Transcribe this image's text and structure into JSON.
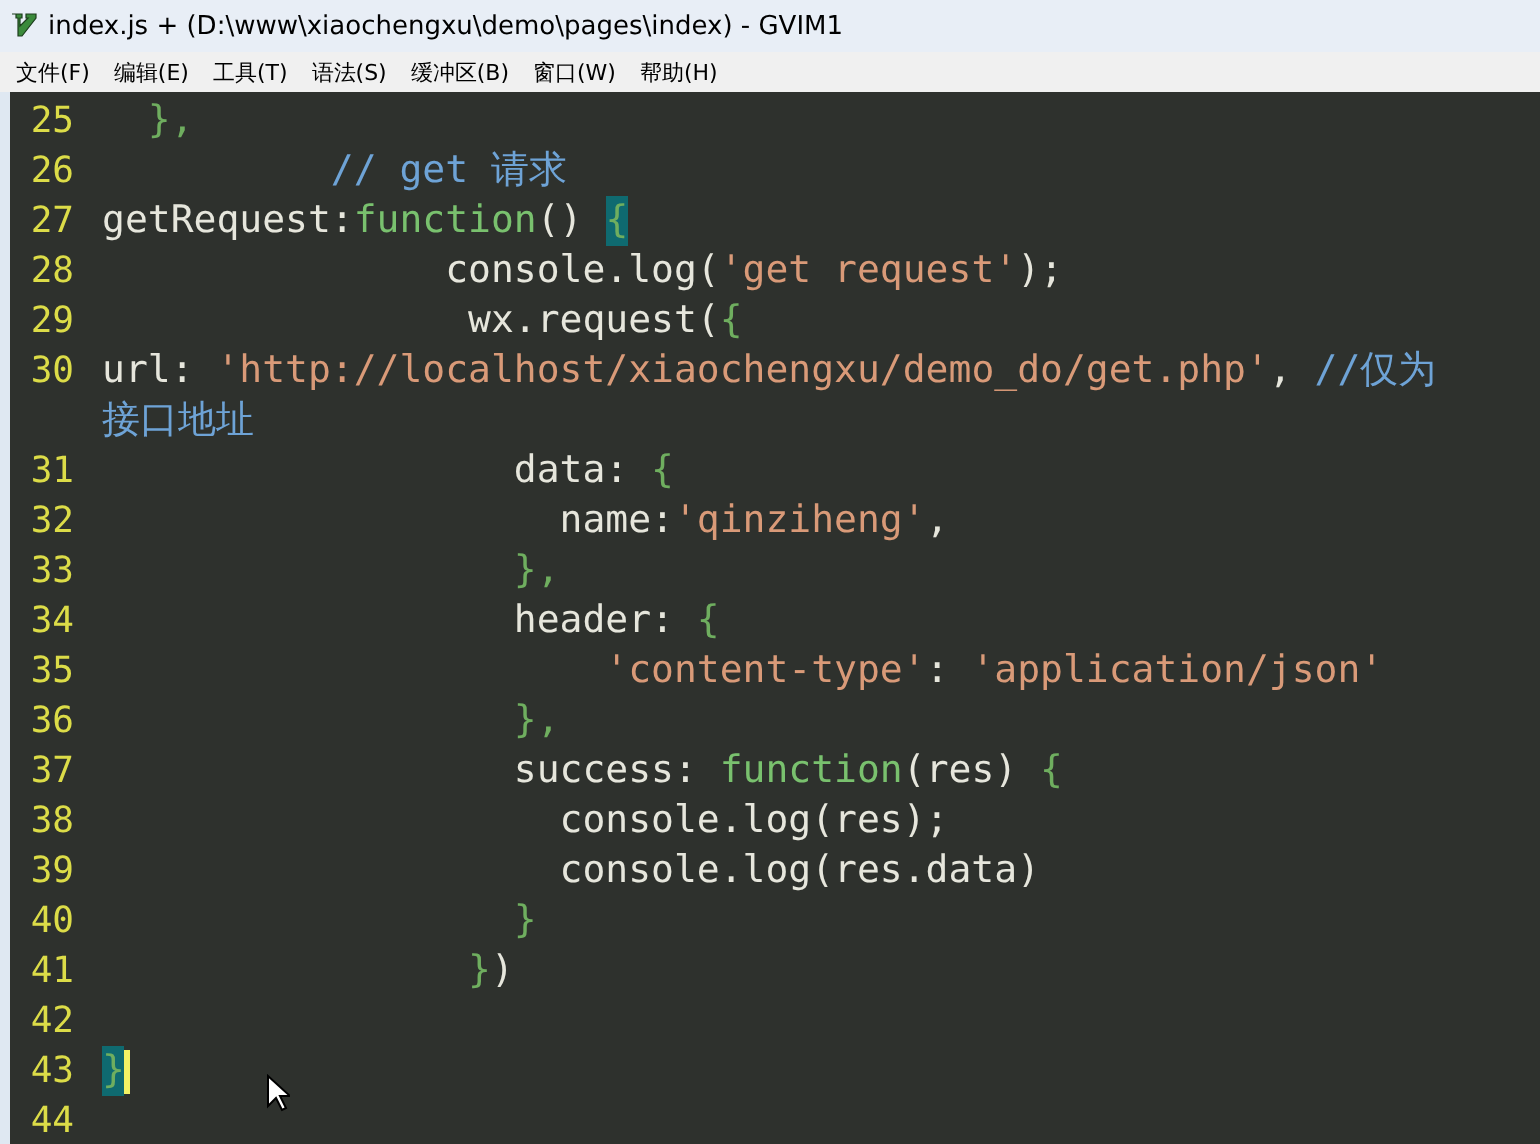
{
  "window": {
    "title": "index.js + (D:\\www\\xiaochengxu\\demo\\pages\\index) - GVIM1"
  },
  "menu": [
    "文件(F)",
    "编辑(E)",
    "工具(T)",
    "语法(S)",
    "缓冲区(B)",
    "窗口(W)",
    "帮助(H)"
  ],
  "lines": [
    {
      "number": "25",
      "cursor": false,
      "tokens": [
        {
          "kind": "punct",
          "text": "  },"
        }
      ]
    },
    {
      "number": "26",
      "cursor": false,
      "tokens": [
        {
          "kind": "comment",
          "text": "          // get 请求"
        }
      ]
    },
    {
      "number": "27",
      "cursor": false,
      "tokens": [
        {
          "kind": "plain",
          "text": "getRequest:"
        },
        {
          "kind": "keyword",
          "text": "function"
        },
        {
          "kind": "plain",
          "text": "() "
        },
        {
          "kind": "match",
          "text": "{"
        }
      ]
    },
    {
      "number": "28",
      "cursor": false,
      "tokens": [
        {
          "kind": "plain",
          "text": "               console.log("
        },
        {
          "kind": "string",
          "text": "'get request'"
        },
        {
          "kind": "plain",
          "text": ");"
        }
      ]
    },
    {
      "number": "29",
      "cursor": false,
      "tokens": [
        {
          "kind": "plain",
          "text": "                wx.request("
        },
        {
          "kind": "punct",
          "text": "{"
        }
      ]
    },
    {
      "number": "30",
      "cursor": false,
      "tokens": [
        {
          "kind": "plain",
          "text": "url: "
        },
        {
          "kind": "string",
          "text": "'http://localhost/xiaochengxu/demo_do/get.php'"
        },
        {
          "kind": "plain",
          "text": ", "
        },
        {
          "kind": "comment",
          "text": "//仅为"
        }
      ],
      "wrap": [
        {
          "kind": "comment",
          "text": "接口地址"
        }
      ]
    },
    {
      "number": "31",
      "cursor": false,
      "tokens": [
        {
          "kind": "plain",
          "text": "                  data: "
        },
        {
          "kind": "punct",
          "text": "{"
        }
      ]
    },
    {
      "number": "32",
      "cursor": false,
      "tokens": [
        {
          "kind": "plain",
          "text": "                    name:"
        },
        {
          "kind": "string",
          "text": "'qinziheng'"
        },
        {
          "kind": "plain",
          "text": ","
        }
      ]
    },
    {
      "number": "33",
      "cursor": false,
      "tokens": [
        {
          "kind": "punct",
          "text": "                  },"
        }
      ]
    },
    {
      "number": "34",
      "cursor": false,
      "tokens": [
        {
          "kind": "plain",
          "text": "                  header: "
        },
        {
          "kind": "punct",
          "text": "{"
        }
      ]
    },
    {
      "number": "35",
      "cursor": false,
      "tokens": [
        {
          "kind": "string",
          "text": "                      'content-type'"
        },
        {
          "kind": "plain",
          "text": ": "
        },
        {
          "kind": "string",
          "text": "'application/json'"
        }
      ]
    },
    {
      "number": "36",
      "cursor": false,
      "tokens": [
        {
          "kind": "punct",
          "text": "                  },"
        }
      ]
    },
    {
      "number": "37",
      "cursor": false,
      "tokens": [
        {
          "kind": "plain",
          "text": "                  success: "
        },
        {
          "kind": "keyword",
          "text": "function"
        },
        {
          "kind": "plain",
          "text": "(res) "
        },
        {
          "kind": "punct",
          "text": "{"
        }
      ]
    },
    {
      "number": "38",
      "cursor": false,
      "tokens": [
        {
          "kind": "plain",
          "text": "                    console.log(res);"
        }
      ]
    },
    {
      "number": "39",
      "cursor": false,
      "tokens": [
        {
          "kind": "plain",
          "text": "                    console.log(res.data)"
        }
      ]
    },
    {
      "number": "40",
      "cursor": false,
      "tokens": [
        {
          "kind": "punct",
          "text": "                  }"
        }
      ]
    },
    {
      "number": "41",
      "cursor": false,
      "tokens": [
        {
          "kind": "punct",
          "text": "                }"
        },
        {
          "kind": "plain",
          "text": ")"
        }
      ]
    },
    {
      "number": "42",
      "cursor": false
    },
    {
      "number": "43",
      "cursor": true,
      "tokens": [
        {
          "kind": "match",
          "text": "}"
        }
      ]
    },
    {
      "number": "44",
      "cursor": false
    }
  ]
}
